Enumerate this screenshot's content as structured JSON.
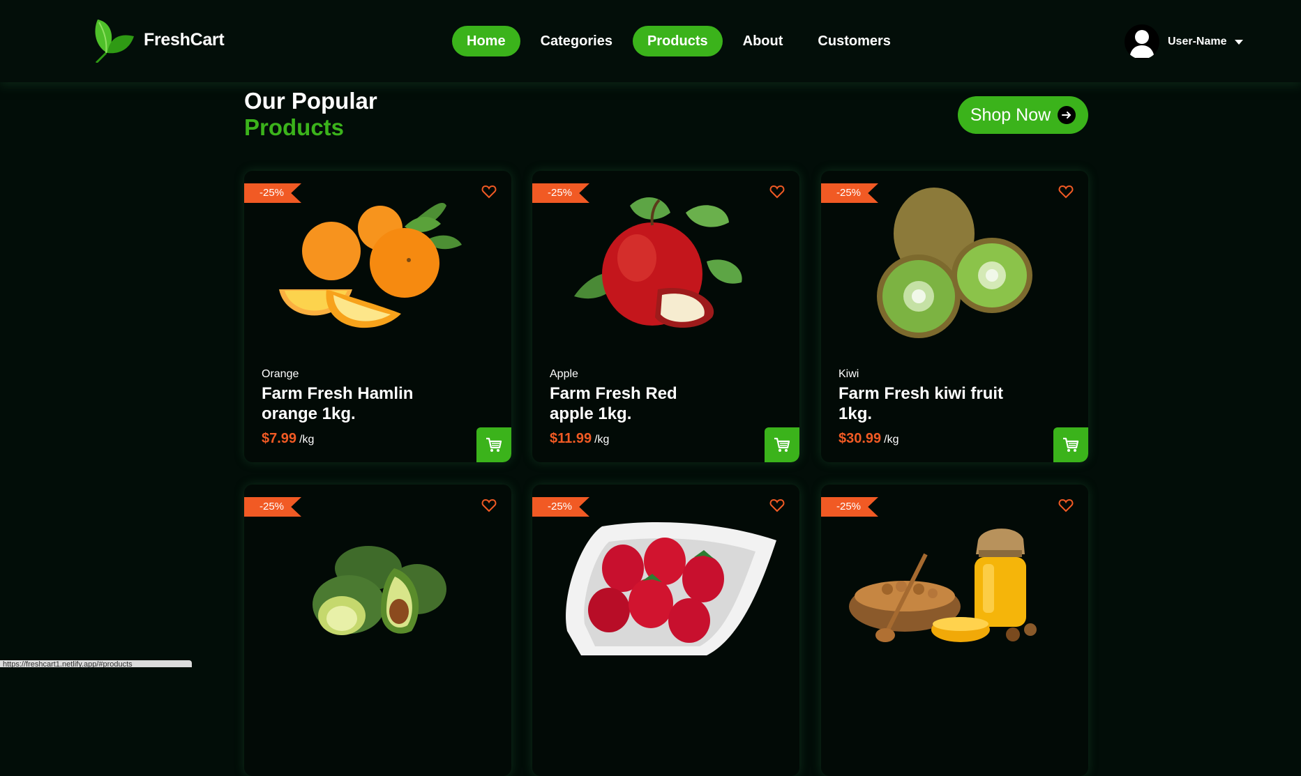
{
  "brand": {
    "name": "FreshCart"
  },
  "nav": [
    {
      "label": "Home",
      "active": true
    },
    {
      "label": "Categories",
      "active": false
    },
    {
      "label": "Products",
      "active": true
    },
    {
      "label": "About",
      "active": false
    },
    {
      "label": "Customers",
      "active": false
    }
  ],
  "user": {
    "name": "User-Name"
  },
  "section": {
    "title_line1": "Our Popular",
    "title_line2": "Products",
    "cta": "Shop Now"
  },
  "products": [
    {
      "discount": "-25%",
      "category": "Orange",
      "name": "Farm Fresh Hamlin orange 1kg.",
      "price": "$7.99",
      "unit": "/kg",
      "image": "oranges"
    },
    {
      "discount": "-25%",
      "category": "Apple",
      "name": "Farm Fresh Red apple 1kg.",
      "price": "$11.99",
      "unit": "/kg",
      "image": "apple"
    },
    {
      "discount": "-25%",
      "category": "Kiwi",
      "name": "Farm Fresh kiwi fruit 1kg.",
      "price": "$30.99",
      "unit": "/kg",
      "image": "kiwi"
    },
    {
      "discount": "-25%",
      "image": "avocado"
    },
    {
      "discount": "-25%",
      "image": "strawberries"
    },
    {
      "discount": "-25%",
      "image": "honey-nuts"
    }
  ],
  "colors": {
    "accent": "#3bb31b",
    "sale": "#f15a24",
    "background": "#020d08"
  },
  "status_url": "https://freshcart1.netlify.app/#products"
}
